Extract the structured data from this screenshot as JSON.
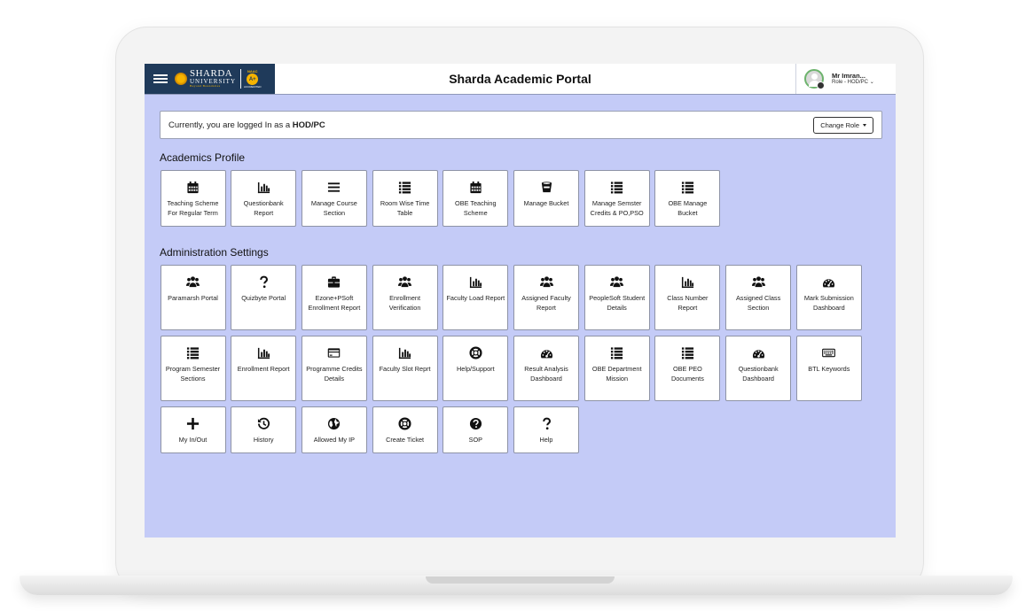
{
  "header": {
    "portal_title": "Sharda Academic Portal",
    "brand_line1": "SHARDA",
    "brand_line2": "UNIVERSITY",
    "brand_line3": "Beyond Boundaries",
    "naac_top": "NAAC",
    "naac_grade": "A+",
    "naac_bottom": "ACCREDITED"
  },
  "user": {
    "name": "Mr Imran...",
    "role": "Role - HOD/PC"
  },
  "login": {
    "prefix": "Currently, you are logged In as a ",
    "role": "HOD/PC",
    "change_role": "Change Role"
  },
  "academics": {
    "title": "Academics Profile",
    "tiles": [
      {
        "label": "Teaching Scheme For Regular Term",
        "icon": "calendar-icon"
      },
      {
        "label": "Questionbank Report",
        "icon": "bar-chart-icon"
      },
      {
        "label": "Manage Course Section",
        "icon": "menu-icon"
      },
      {
        "label": "Room Wise Time Table",
        "icon": "list-icon"
      },
      {
        "label": "OBE Teaching Scheme",
        "icon": "calendar-icon"
      },
      {
        "label": "Manage Bucket",
        "icon": "bucket-icon"
      },
      {
        "label": "Manage Semster Credits & PO,PSO",
        "icon": "list-icon"
      },
      {
        "label": "OBE Manage Bucket",
        "icon": "list-icon"
      }
    ]
  },
  "administration": {
    "title": "Administration Settings",
    "tiles": [
      {
        "label": "Paramarsh Portal",
        "icon": "users-icon"
      },
      {
        "label": "Quizbyte Portal",
        "icon": "question-icon"
      },
      {
        "label": "Ezone+PSoft Enrollment Report",
        "icon": "briefcase-icon"
      },
      {
        "label": "Enrollment Verification",
        "icon": "users-icon"
      },
      {
        "label": "Faculty Load Report",
        "icon": "bar-chart-icon"
      },
      {
        "label": "Assigned Faculty Report",
        "icon": "users-icon"
      },
      {
        "label": "PeopleSoft Student Details",
        "icon": "users-icon"
      },
      {
        "label": "Class Number Report",
        "icon": "bar-chart-icon"
      },
      {
        "label": "Assigned Class Section",
        "icon": "users-icon"
      },
      {
        "label": "Mark Submission Dashboard",
        "icon": "dashboard-icon"
      },
      {
        "label": "Program Semester Sections",
        "icon": "list-icon"
      },
      {
        "label": "Enrollment Report",
        "icon": "bar-chart-icon"
      },
      {
        "label": "Programme Credits Details",
        "icon": "credit-card-icon"
      },
      {
        "label": "Faculty Slot Reprt",
        "icon": "bar-chart-icon"
      },
      {
        "label": "Help/Support",
        "icon": "life-ring-icon"
      },
      {
        "label": "Result Analysis Dashboard",
        "icon": "dashboard-icon"
      },
      {
        "label": "OBE Department Mission",
        "icon": "list-icon"
      },
      {
        "label": "OBE PEO Documents",
        "icon": "list-icon"
      },
      {
        "label": "Questionbank Dashboard",
        "icon": "dashboard-icon"
      },
      {
        "label": "BTL Keywords",
        "icon": "keyboard-icon"
      },
      {
        "label": "My In/Out",
        "icon": "plus-icon"
      },
      {
        "label": "History",
        "icon": "history-icon"
      },
      {
        "label": "Allowed My IP",
        "icon": "globe-icon"
      },
      {
        "label": "Create Ticket",
        "icon": "life-ring-icon"
      },
      {
        "label": "SOP",
        "icon": "question-circle-icon"
      },
      {
        "label": "Help",
        "icon": "question-icon"
      }
    ]
  }
}
